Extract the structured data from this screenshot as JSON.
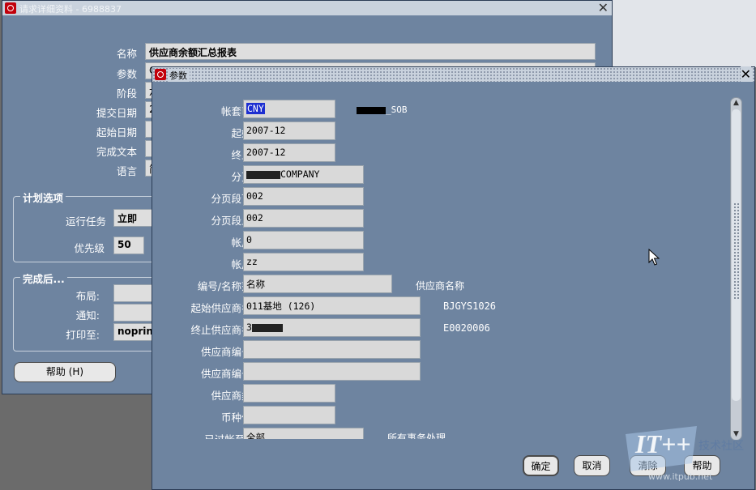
{
  "request_window": {
    "title": "请求详细资料 - 6988837",
    "fields": [
      {
        "label": "名称",
        "value": "供应商余额汇总报表"
      },
      {
        "label": "参数",
        "value": "C"
      },
      {
        "label": "阶段",
        "value": "六"
      },
      {
        "label": "提交日期",
        "value": "2"
      },
      {
        "label": "起始日期",
        "value": ""
      },
      {
        "label": "完成文本",
        "value": ""
      },
      {
        "label": "语言",
        "value": "简"
      }
    ],
    "schedule": {
      "title": "计划选项",
      "run_label": "运行任务",
      "run_value": "立即",
      "priority_label": "优先级",
      "priority_value": "50"
    },
    "completion": {
      "title": "完成后...",
      "layout_label": "布局:",
      "layout_value": "",
      "notify_label": "通知:",
      "notify_value": "",
      "print_label": "打印至:",
      "print_value": "noprint"
    },
    "help_button": "帮助 (H)"
  },
  "param_dialog": {
    "title": "参数",
    "rows": [
      {
        "label": "帐套币种",
        "value": "CNY",
        "note": "_SOB"
      },
      {
        "label": "起始期",
        "value": "2007-12",
        "note": ""
      },
      {
        "label": "终止期",
        "value": "2007-12",
        "note": ""
      },
      {
        "label": "分页段",
        "value": "COMPANY",
        "note": ""
      },
      {
        "label": "分页段下限",
        "value": "002",
        "note": ""
      },
      {
        "label": "分页段上限",
        "value": "002",
        "note": ""
      },
      {
        "label": "帐户自",
        "value": "0",
        "note": ""
      },
      {
        "label": "帐户至",
        "value": "zz",
        "note": ""
      },
      {
        "label": "编号/名称范围",
        "value": "名称",
        "note": "供应商名称"
      },
      {
        "label": "起始供应商名称",
        "value": "011基地 (126)",
        "note": "BJGYS1026"
      },
      {
        "label": "终止供应商名称",
        "value": "3",
        "note": "E0020006"
      },
      {
        "label": "供应商编号自",
        "value": "",
        "note": ""
      },
      {
        "label": "供应商编号至",
        "value": "",
        "note": ""
      },
      {
        "label": "供应商类型",
        "value": "",
        "note": ""
      },
      {
        "label": "币种代码",
        "value": "",
        "note": ""
      },
      {
        "label": "已过帐至 GL",
        "value": "全部",
        "note": "所有事务处理"
      }
    ],
    "buttons": {
      "ok": "确定",
      "cancel": "取消",
      "clear": "清除",
      "help": "帮助"
    }
  },
  "watermark": {
    "brand": "IT++",
    "sub": "技术社区",
    "url": "www.itpub.net"
  },
  "colors": {
    "window_bg": "#6e84a0",
    "titlebar": "#c9d2dd",
    "field_bg": "#d9d9d9",
    "logo_red": "#c2000b",
    "selection": "#1d2fd1"
  },
  "icons": [
    "oracle-logo-icon",
    "close-icon",
    "scroll-up-icon",
    "scroll-down-icon",
    "mouse-pointer-icon"
  ]
}
